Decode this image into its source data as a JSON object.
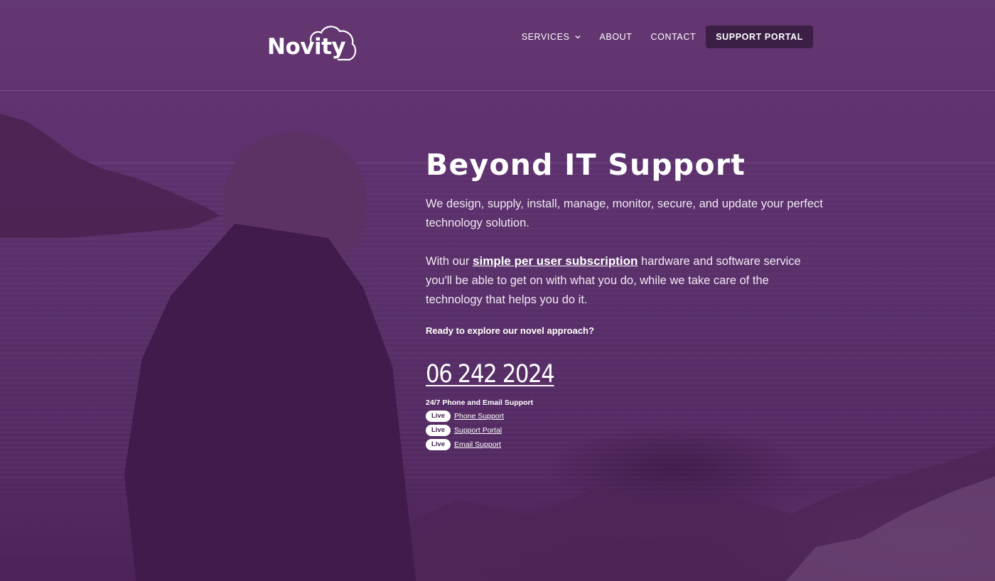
{
  "brand": {
    "logo_text": "Novity"
  },
  "nav": {
    "items": [
      {
        "label": "SERVICES",
        "has_dropdown": true
      },
      {
        "label": "ABOUT"
      },
      {
        "label": "CONTACT"
      }
    ],
    "portal_button": "SUPPORT PORTAL"
  },
  "hero": {
    "title": "Beyond IT Support",
    "paragraph1": "We design, supply, install, manage, monitor, secure, and update your perfect technology solution.",
    "paragraph2_prefix": "With our ",
    "paragraph2_link": "simple per user subscription",
    "paragraph2_suffix": " hardware and software service you'll be able to get on with what you do, while we take care of the technology that helps you do it.",
    "cta": "Ready to explore our novel approach?",
    "phone": "06 242 2024",
    "support_title": "24/7 Phone and Email Support",
    "support_items": [
      {
        "badge": "Live",
        "label": "Phone Support"
      },
      {
        "badge": "Live",
        "label": "Support Portal"
      },
      {
        "badge": "Live",
        "label": "Email Support"
      }
    ]
  },
  "colors": {
    "background_tint": "#5e3270",
    "portal_button_bg": "#3b1f44",
    "badge_bg": "#ffffff",
    "badge_text": "#4a2452"
  },
  "icons": [
    "cloud-logo-icon",
    "chevron-down-icon"
  ]
}
